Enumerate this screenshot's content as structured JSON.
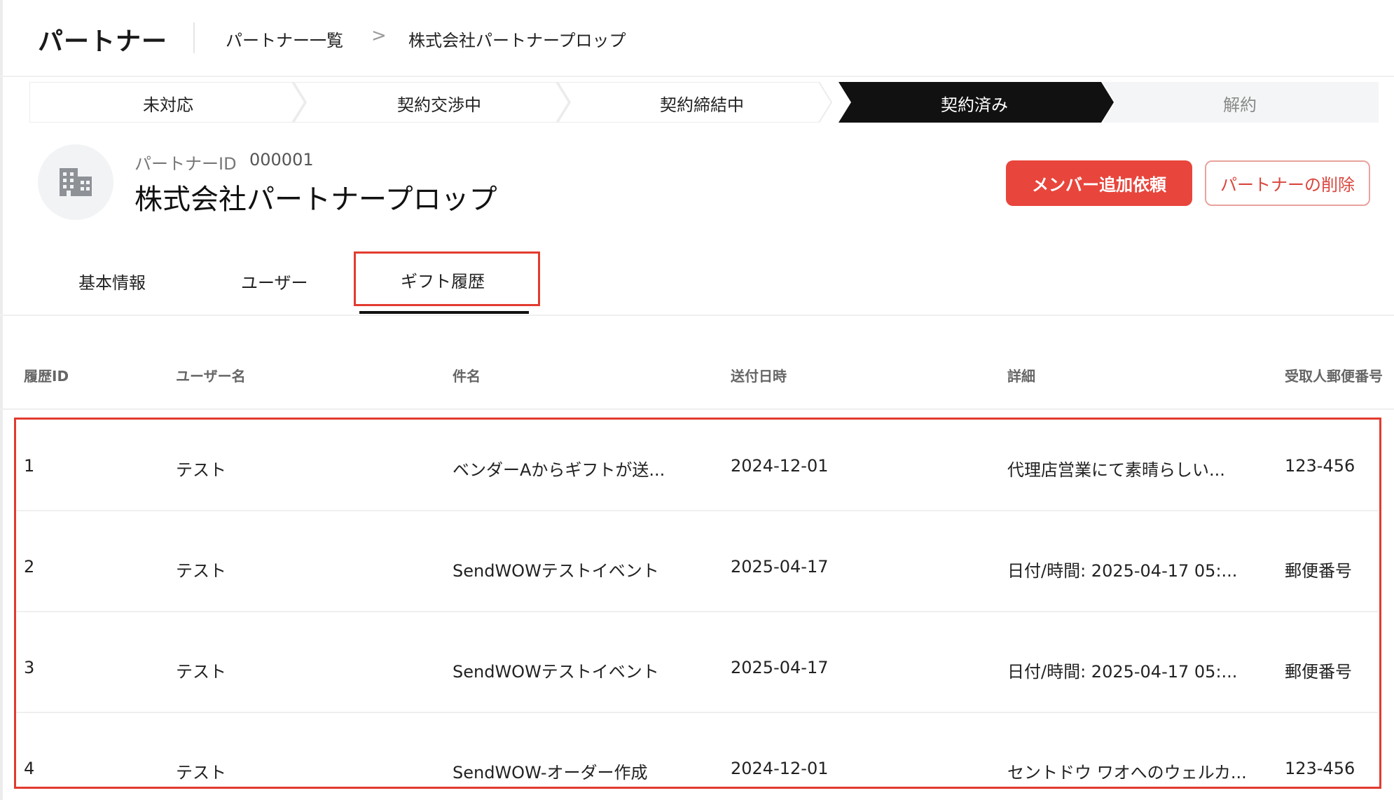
{
  "header": {
    "app_title": "パートナー",
    "breadcrumb": [
      "パートナー一覧",
      "株式会社パートナープロップ"
    ],
    "breadcrumb_separator": ">"
  },
  "stepper": {
    "steps": [
      {
        "label": "未対応",
        "state": "done"
      },
      {
        "label": "契約交渉中",
        "state": "done"
      },
      {
        "label": "契約締結中",
        "state": "done"
      },
      {
        "label": "契約済み",
        "state": "active"
      },
      {
        "label": "解約",
        "state": "future"
      }
    ]
  },
  "partner": {
    "id_label": "パートナーID",
    "id_value": "000001",
    "name": "株式会社パートナープロップ",
    "avatar_icon": "building-icon"
  },
  "actions": {
    "request_member_label": "メンバー追加依頼",
    "delete_partner_label": "パートナーの削除"
  },
  "tabs": [
    {
      "label": "基本情報",
      "active": false
    },
    {
      "label": "ユーザー",
      "active": false
    },
    {
      "label": "ギフト履歴",
      "active": true
    }
  ],
  "table": {
    "columns": [
      "履歴ID",
      "ユーザー名",
      "件名",
      "送付日時",
      "詳細",
      "受取人郵便番号"
    ],
    "rows": [
      [
        "1",
        "テスト",
        "ベンダーAからギフトが送...",
        "2024-12-01",
        "代理店営業にて素晴らしい...",
        "123-456"
      ],
      [
        "2",
        "テスト",
        "SendWOWテストイベント",
        "2025-04-17",
        "日付/時間: 2025-04-17 05:...",
        "郵便番号"
      ],
      [
        "3",
        "テスト",
        "SendWOWテストイベント",
        "2025-04-17",
        "日付/時間: 2025-04-17 05:...",
        "郵便番号"
      ],
      [
        "4",
        "テスト",
        "SendWOW-オーダー作成",
        "2024-12-01",
        "セントドウ ワオへのウェルカ...",
        "123-456"
      ]
    ]
  },
  "colors": {
    "accent_red": "#e8453c",
    "highlight_red": "#e23b2f",
    "active_step": "#111111",
    "step_bg": "#f4f5f6"
  }
}
